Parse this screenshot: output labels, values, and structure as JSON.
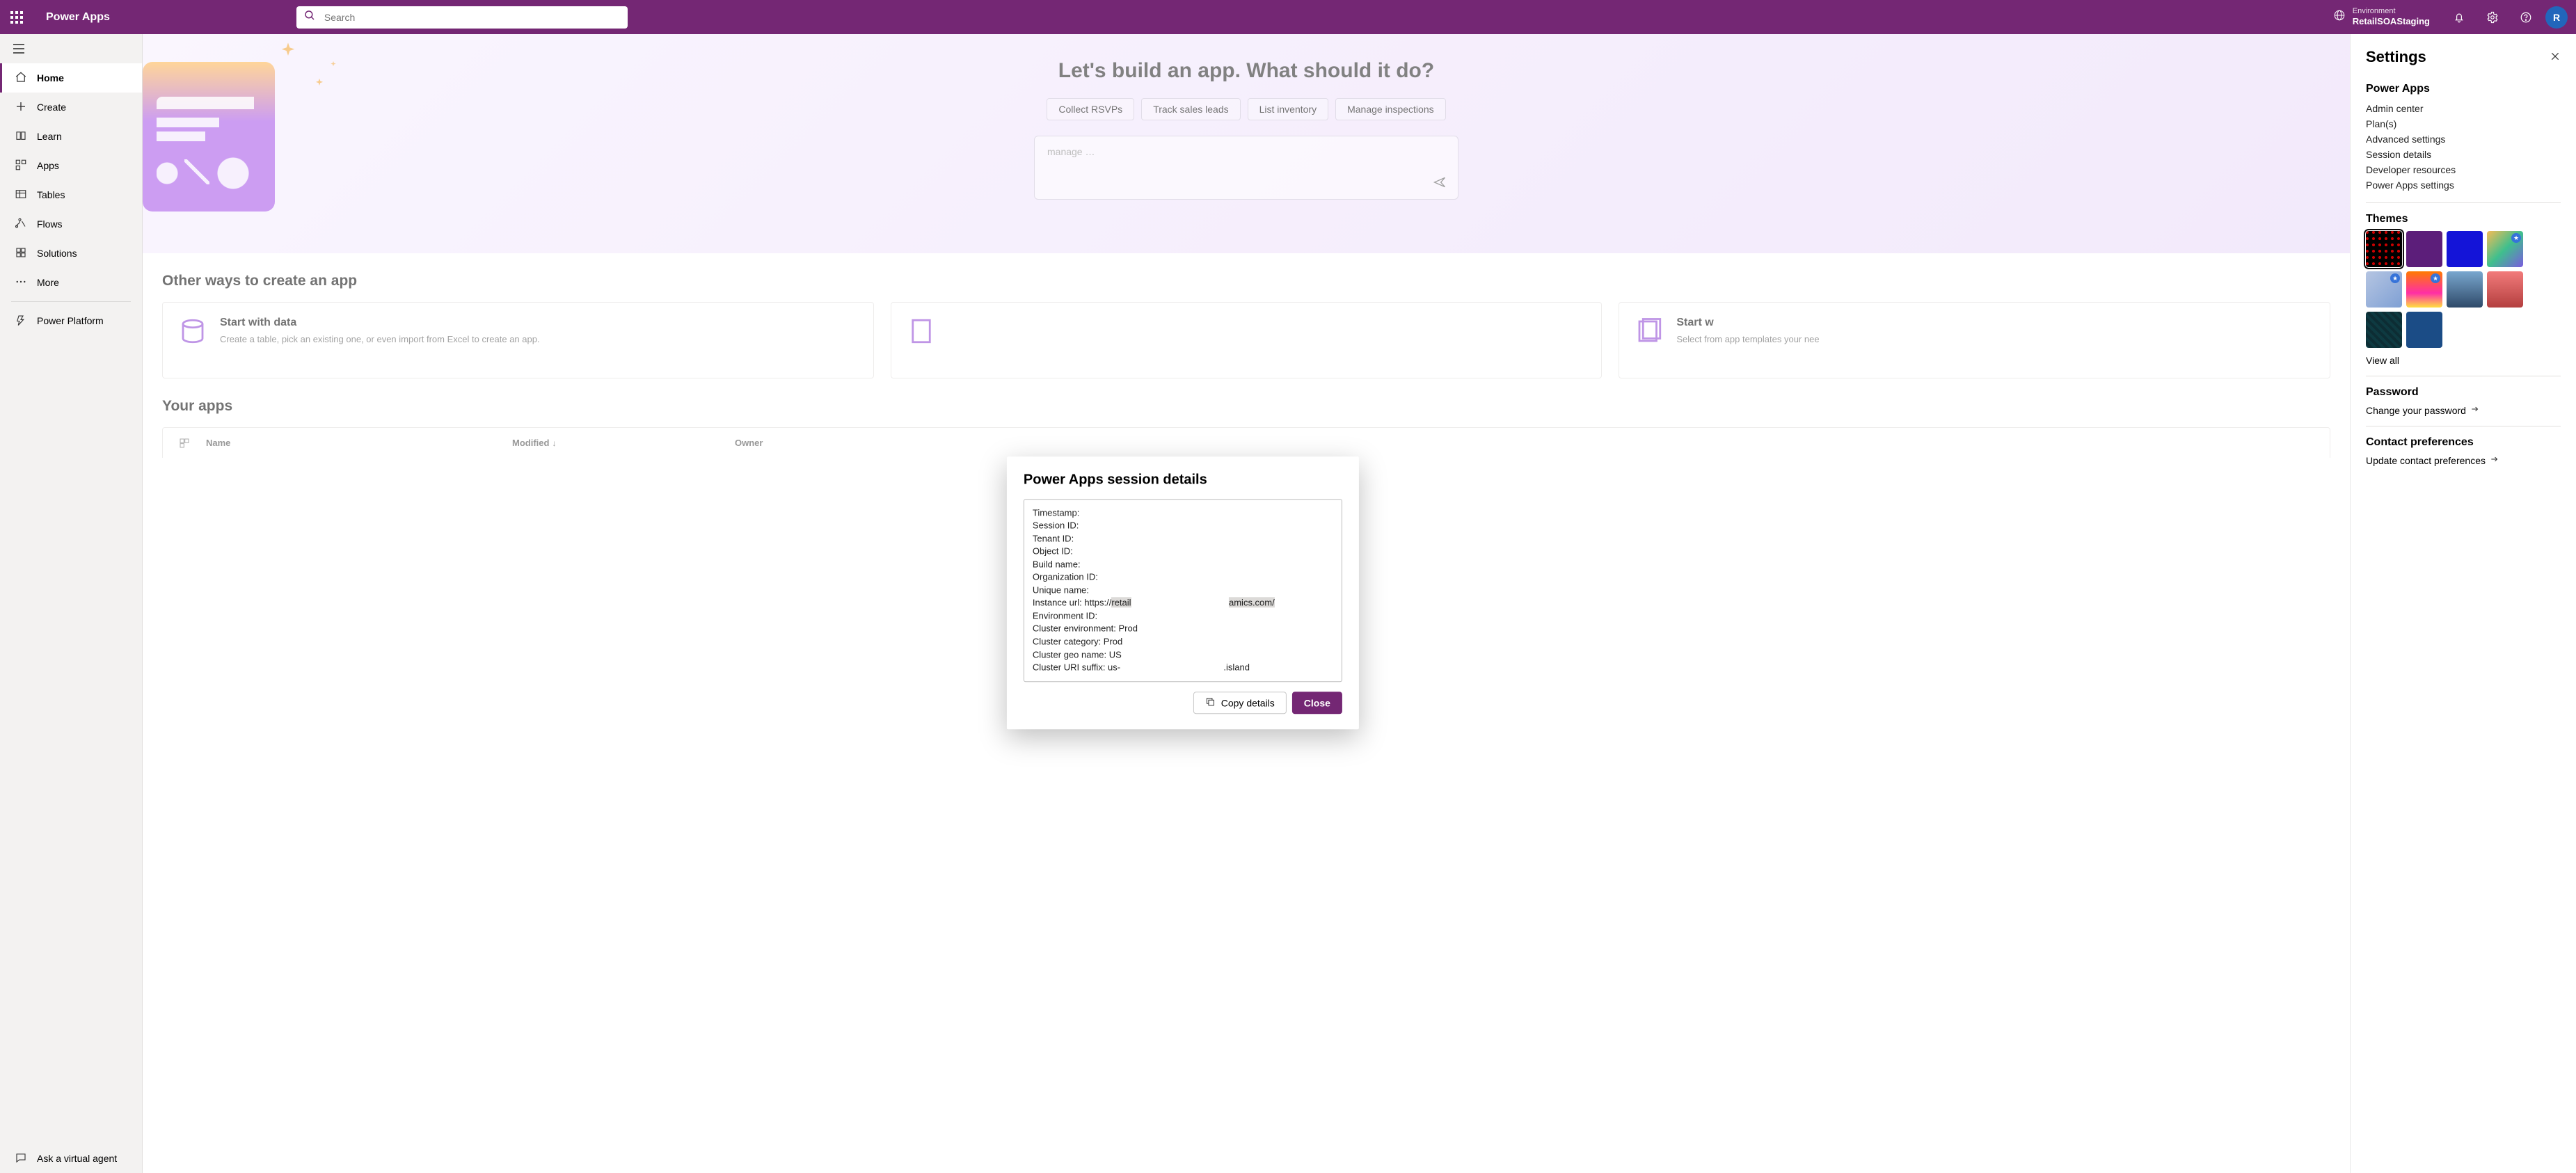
{
  "app": {
    "title": "Power Apps",
    "avatar_initial": "R"
  },
  "search": {
    "placeholder": "Search"
  },
  "environment": {
    "label": "Environment",
    "name": "RetailSOAStaging"
  },
  "nav": {
    "items": [
      {
        "label": "Home"
      },
      {
        "label": "Create"
      },
      {
        "label": "Learn"
      },
      {
        "label": "Apps"
      },
      {
        "label": "Tables"
      },
      {
        "label": "Flows"
      },
      {
        "label": "Solutions"
      },
      {
        "label": "More"
      },
      {
        "label": "Power Platform"
      }
    ],
    "agent": "Ask a virtual agent"
  },
  "hero": {
    "title": "Let's build an app. What should it do?",
    "chips": [
      "Collect RSVPs",
      "Track sales leads",
      "List inventory",
      "Manage inspections"
    ],
    "prompt_placeholder": "manage …"
  },
  "create": {
    "heading": "Other ways to create an app",
    "cards": [
      {
        "title": "Start with data",
        "desc": "Create a table, pick an existing one, or even import from Excel to create an app."
      },
      {
        "title": "",
        "desc": ""
      },
      {
        "title": "Start w",
        "desc": "Select from app templates your nee"
      }
    ]
  },
  "apps": {
    "heading": "Your apps",
    "columns": {
      "name": "Name",
      "modified": "Modified",
      "owner": "Owner"
    }
  },
  "settings": {
    "title": "Settings",
    "section_app": "Power Apps",
    "links": [
      "Admin center",
      "Plan(s)",
      "Advanced settings",
      "Session details",
      "Developer resources",
      "Power Apps settings"
    ],
    "section_themes": "Themes",
    "view_all": "View all",
    "section_password": "Password",
    "password_link": "Change your password",
    "section_contact": "Contact preferences",
    "contact_link": "Update contact preferences"
  },
  "themes": [
    {
      "bg": "radial-gradient(circle at 2px 2px,#c80000 2px,transparent 2.2px) 0 0/9px 9px,#000",
      "selected": true
    },
    {
      "bg": "#5c1e7a"
    },
    {
      "bg": "#1414d8"
    },
    {
      "bg": "linear-gradient(135deg,#f6bc54,#3fbf8d,#7a5be0)",
      "star": true
    },
    {
      "bg": "linear-gradient(135deg,#b5c5e2,#7fa0d4)",
      "star": true
    },
    {
      "bg": "linear-gradient(180deg,#ff7a00,#ff2ea6 60%,#ffe040)",
      "star": true
    },
    {
      "bg": "linear-gradient(180deg,#79a7cf,#2f4a69)"
    },
    {
      "bg": "linear-gradient(180deg,#f27b7b,#b43f3f)"
    },
    {
      "bg": "#0d2d34 repeating-linear-gradient(45deg,#0e3a41 0 4px,transparent 4px 8px)"
    },
    {
      "bg": "#1b4c86"
    }
  ],
  "modal": {
    "title": "Power Apps session details",
    "copy": "Copy details",
    "close": "Close",
    "session": {
      "p0": "Timestamp: ",
      "p1": "Session ID: ",
      "p2": "Tenant ID: ",
      "p3": "Object ID: ",
      "p4": "Build name: ",
      "p5": "Organization ID: ",
      "p6": "Unique name: ",
      "p7a": "Instance url: https://",
      "p7b": "retail",
      "p7c": "amics.com/",
      "p8": "Environment ID: ",
      "p9": "Cluster environment: Prod",
      "p10": "Cluster category: Prod",
      "p11": "Cluster geo name: US",
      "p12a": "Cluster URI suffix: us-",
      "p12b": ".island"
    }
  }
}
